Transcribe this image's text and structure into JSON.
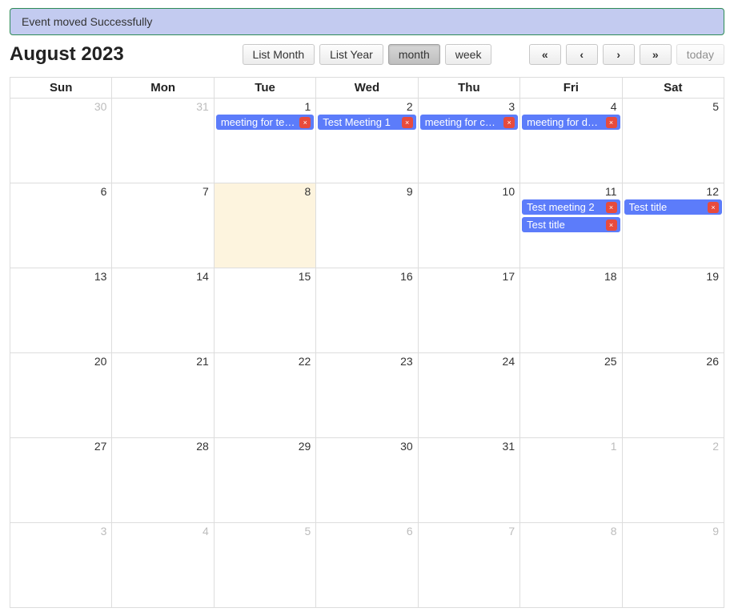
{
  "alert": {
    "message": "Event moved Successfully"
  },
  "header": {
    "title": "August 2023",
    "views": {
      "list_month": "List Month",
      "list_year": "List Year",
      "month": "month",
      "week": "week",
      "active": "month"
    },
    "nav": {
      "prev_more": "«",
      "prev": "‹",
      "next": "›",
      "next_more": "»",
      "today": "today"
    }
  },
  "day_headers": [
    "Sun",
    "Mon",
    "Tue",
    "Wed",
    "Thu",
    "Fri",
    "Sat"
  ],
  "weeks": [
    {
      "days": [
        {
          "num": "30",
          "other": true,
          "hl": false,
          "events": []
        },
        {
          "num": "31",
          "other": true,
          "hl": false,
          "events": []
        },
        {
          "num": "1",
          "other": false,
          "hl": false,
          "events": [
            {
              "title": "meeting for testing"
            }
          ]
        },
        {
          "num": "2",
          "other": false,
          "hl": false,
          "events": [
            {
              "title": "Test Meeting 1"
            }
          ]
        },
        {
          "num": "3",
          "other": false,
          "hl": false,
          "events": [
            {
              "title": "meeting for changes"
            }
          ]
        },
        {
          "num": "4",
          "other": false,
          "hl": false,
          "events": [
            {
              "title": "meeting for deployment"
            }
          ]
        },
        {
          "num": "5",
          "other": false,
          "hl": false,
          "events": []
        }
      ]
    },
    {
      "days": [
        {
          "num": "6",
          "other": false,
          "hl": false,
          "events": []
        },
        {
          "num": "7",
          "other": false,
          "hl": false,
          "events": []
        },
        {
          "num": "8",
          "other": false,
          "hl": true,
          "events": []
        },
        {
          "num": "9",
          "other": false,
          "hl": false,
          "events": []
        },
        {
          "num": "10",
          "other": false,
          "hl": false,
          "events": []
        },
        {
          "num": "11",
          "other": false,
          "hl": false,
          "events": [
            {
              "title": "Test meeting 2"
            },
            {
              "title": "Test title"
            }
          ]
        },
        {
          "num": "12",
          "other": false,
          "hl": false,
          "events": [
            {
              "title": "Test title"
            }
          ]
        }
      ]
    },
    {
      "days": [
        {
          "num": "13",
          "other": false,
          "hl": false,
          "events": []
        },
        {
          "num": "14",
          "other": false,
          "hl": false,
          "events": []
        },
        {
          "num": "15",
          "other": false,
          "hl": false,
          "events": []
        },
        {
          "num": "16",
          "other": false,
          "hl": false,
          "events": []
        },
        {
          "num": "17",
          "other": false,
          "hl": false,
          "events": []
        },
        {
          "num": "18",
          "other": false,
          "hl": false,
          "events": []
        },
        {
          "num": "19",
          "other": false,
          "hl": false,
          "events": []
        }
      ]
    },
    {
      "days": [
        {
          "num": "20",
          "other": false,
          "hl": false,
          "events": []
        },
        {
          "num": "21",
          "other": false,
          "hl": false,
          "events": []
        },
        {
          "num": "22",
          "other": false,
          "hl": false,
          "events": []
        },
        {
          "num": "23",
          "other": false,
          "hl": false,
          "events": []
        },
        {
          "num": "24",
          "other": false,
          "hl": false,
          "events": []
        },
        {
          "num": "25",
          "other": false,
          "hl": false,
          "events": []
        },
        {
          "num": "26",
          "other": false,
          "hl": false,
          "events": []
        }
      ]
    },
    {
      "days": [
        {
          "num": "27",
          "other": false,
          "hl": false,
          "events": []
        },
        {
          "num": "28",
          "other": false,
          "hl": false,
          "events": []
        },
        {
          "num": "29",
          "other": false,
          "hl": false,
          "events": []
        },
        {
          "num": "30",
          "other": false,
          "hl": false,
          "events": []
        },
        {
          "num": "31",
          "other": false,
          "hl": false,
          "events": []
        },
        {
          "num": "1",
          "other": true,
          "hl": false,
          "events": []
        },
        {
          "num": "2",
          "other": true,
          "hl": false,
          "events": []
        }
      ]
    },
    {
      "days": [
        {
          "num": "3",
          "other": true,
          "hl": false,
          "events": []
        },
        {
          "num": "4",
          "other": true,
          "hl": false,
          "events": []
        },
        {
          "num": "5",
          "other": true,
          "hl": false,
          "events": []
        },
        {
          "num": "6",
          "other": true,
          "hl": false,
          "events": []
        },
        {
          "num": "7",
          "other": true,
          "hl": false,
          "events": []
        },
        {
          "num": "8",
          "other": true,
          "hl": false,
          "events": []
        },
        {
          "num": "9",
          "other": true,
          "hl": false,
          "events": []
        }
      ]
    }
  ]
}
